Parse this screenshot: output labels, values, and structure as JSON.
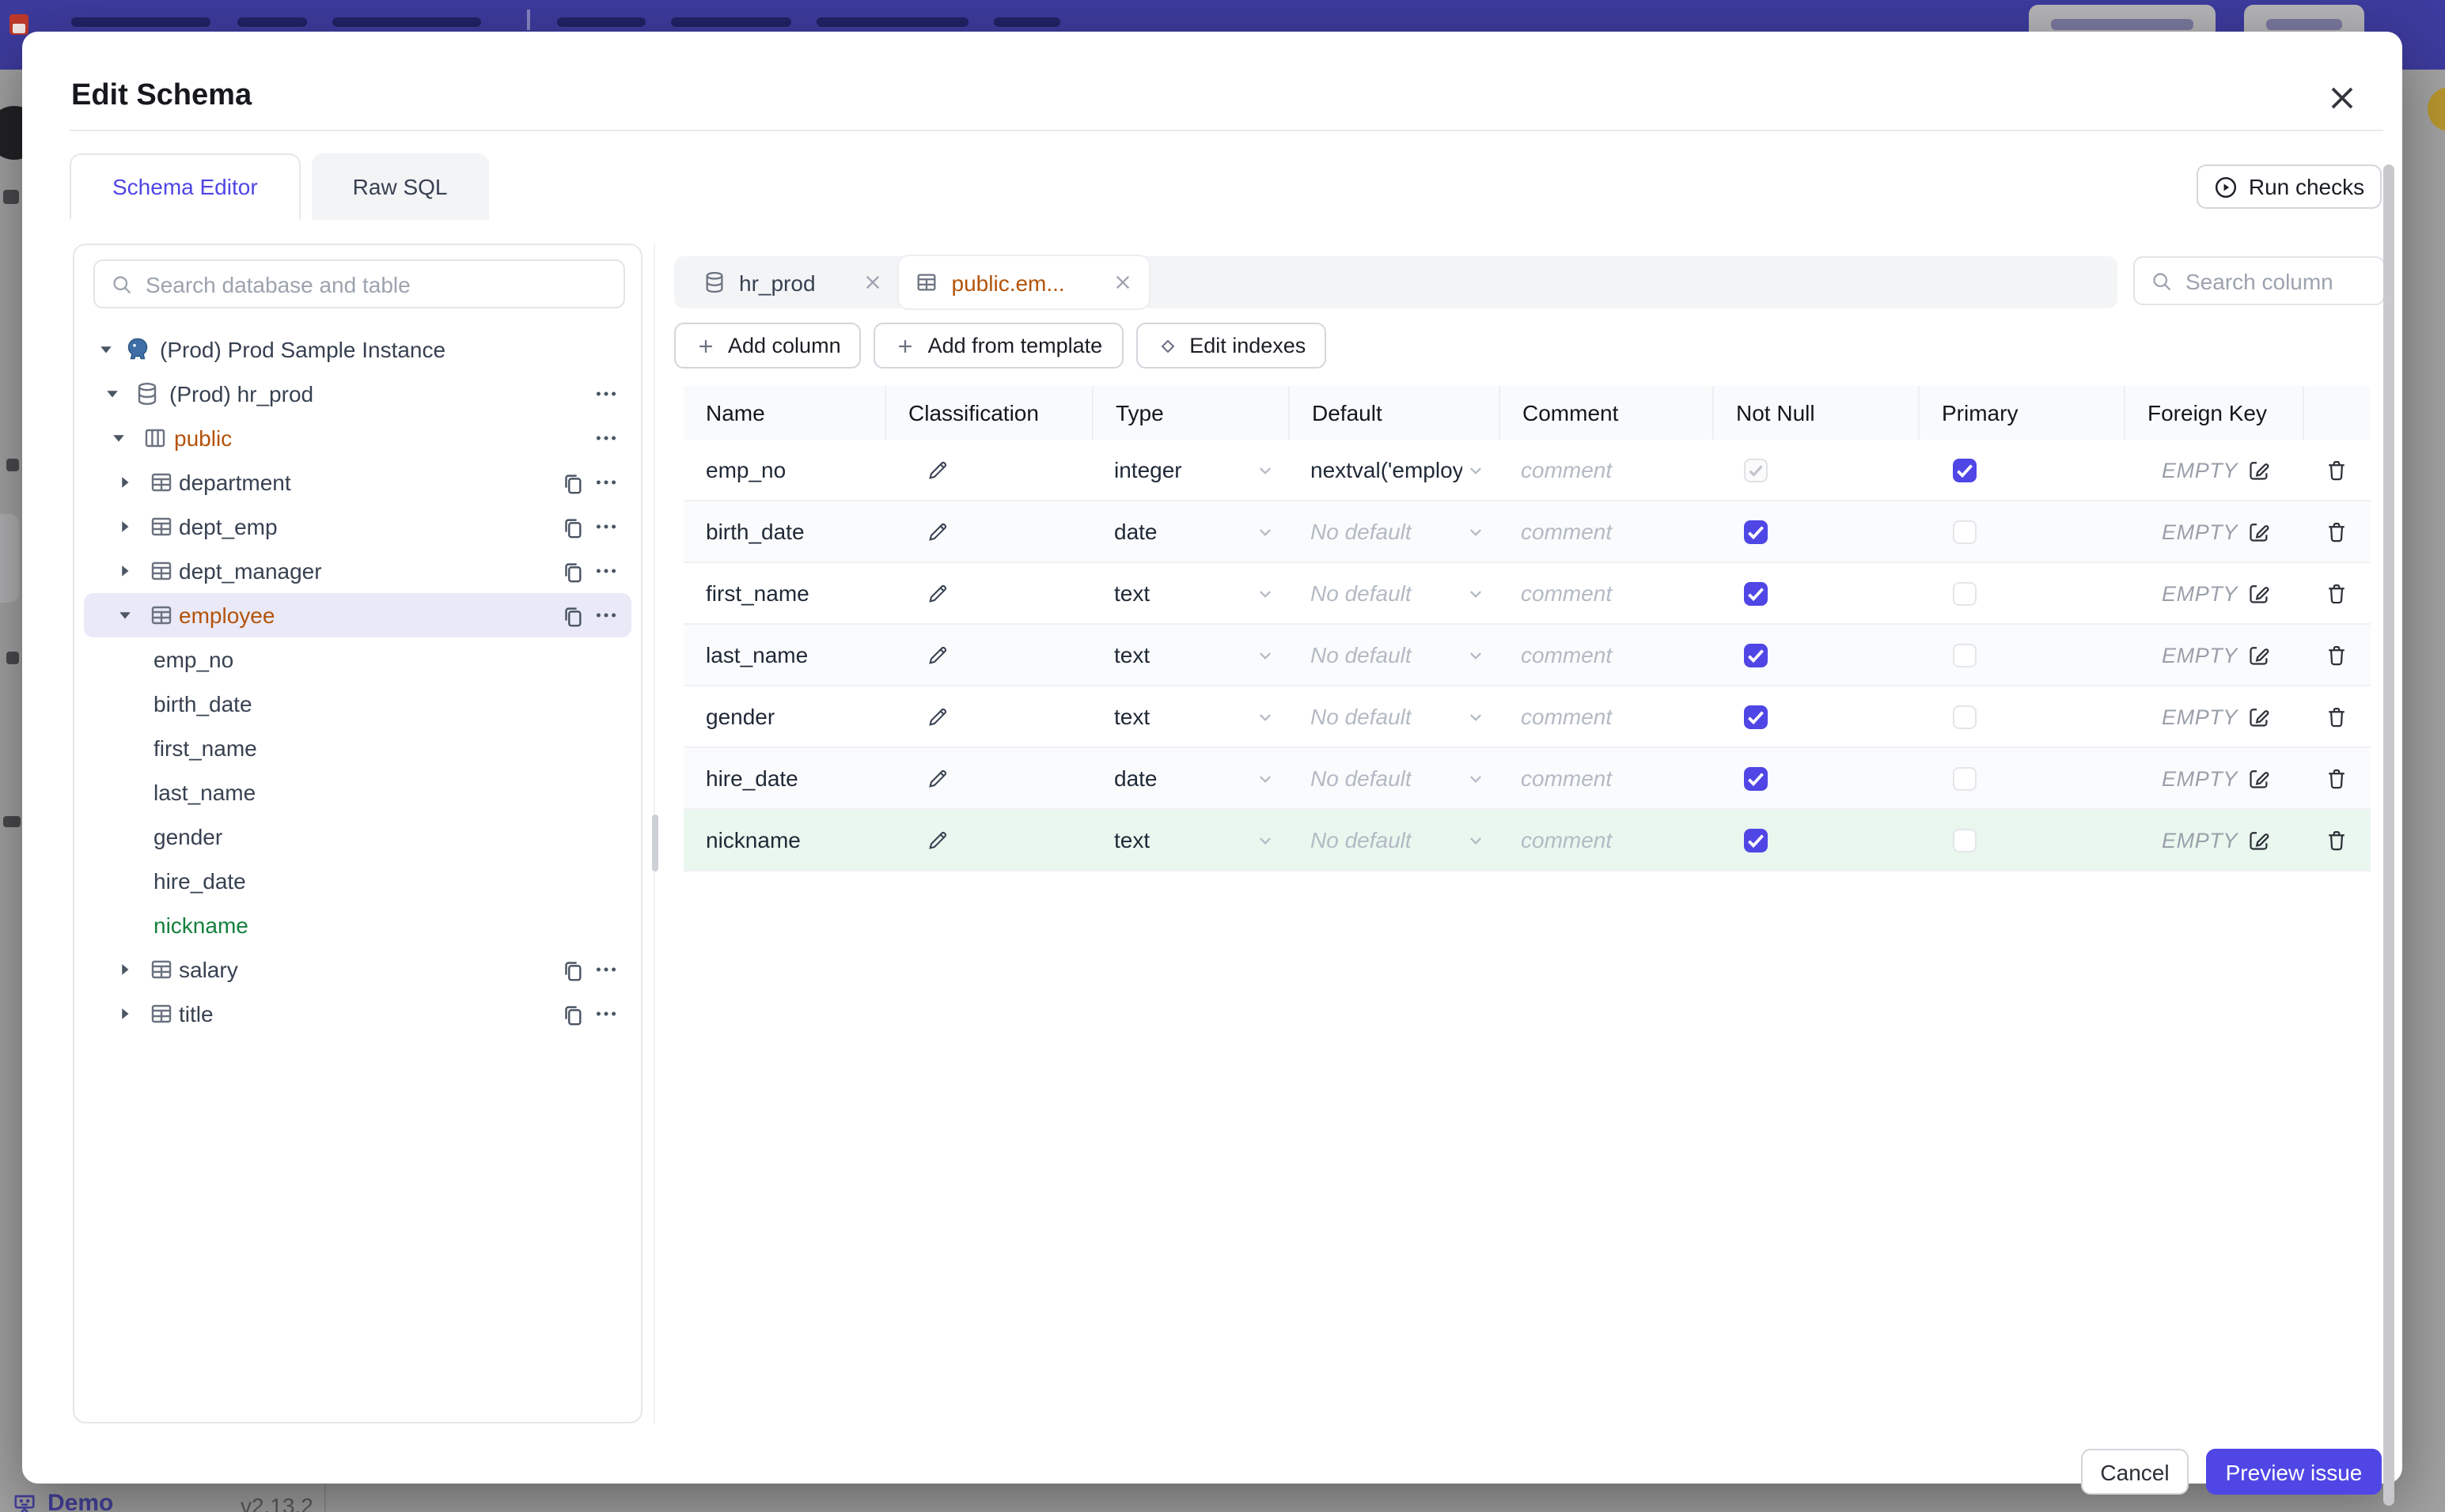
{
  "colors": {
    "accent": "#4f46e5",
    "header_bar": "#3d3b9d",
    "orange_modified": "#b45309",
    "green_new": "#15803d",
    "green_row_bg": "#e9f7ef",
    "selected_tree_bg": "#e9e9f8"
  },
  "modal": {
    "title": "Edit Schema",
    "tabs": [
      {
        "label": "Schema Editor",
        "active": true
      },
      {
        "label": "Raw SQL",
        "active": false
      }
    ],
    "run_checks_label": "Run checks",
    "sidebar": {
      "search_placeholder": "Search database and table",
      "tree": [
        {
          "level": 1,
          "caret": "down",
          "icon": "postgres",
          "label": "(Prod) Prod Sample Instance",
          "color": "default",
          "copy": false,
          "dots": false,
          "selected": false
        },
        {
          "level": 2,
          "caret": "down",
          "icon": "database",
          "label": "(Prod) hr_prod",
          "color": "default",
          "copy": false,
          "dots": true,
          "selected": false
        },
        {
          "level": 3,
          "caret": "down",
          "icon": "schema",
          "label": "public",
          "color": "orange",
          "copy": false,
          "dots": true,
          "selected": false
        },
        {
          "level": 4,
          "caret": "right",
          "icon": "table",
          "label": "department",
          "color": "default",
          "copy": true,
          "dots": true,
          "selected": false
        },
        {
          "level": 4,
          "caret": "right",
          "icon": "table",
          "label": "dept_emp",
          "color": "default",
          "copy": true,
          "dots": true,
          "selected": false
        },
        {
          "level": 4,
          "caret": "right",
          "icon": "table",
          "label": "dept_manager",
          "color": "default",
          "copy": true,
          "dots": true,
          "selected": false
        },
        {
          "level": 4,
          "caret": "down",
          "icon": "table",
          "label": "employee",
          "color": "orange",
          "copy": true,
          "dots": true,
          "selected": true
        },
        {
          "level": 5,
          "caret": null,
          "icon": null,
          "label": "emp_no",
          "color": "default",
          "copy": false,
          "dots": false,
          "selected": false
        },
        {
          "level": 5,
          "caret": null,
          "icon": null,
          "label": "birth_date",
          "color": "default",
          "copy": false,
          "dots": false,
          "selected": false
        },
        {
          "level": 5,
          "caret": null,
          "icon": null,
          "label": "first_name",
          "color": "default",
          "copy": false,
          "dots": false,
          "selected": false
        },
        {
          "level": 5,
          "caret": null,
          "icon": null,
          "label": "last_name",
          "color": "default",
          "copy": false,
          "dots": false,
          "selected": false
        },
        {
          "level": 5,
          "caret": null,
          "icon": null,
          "label": "gender",
          "color": "default",
          "copy": false,
          "dots": false,
          "selected": false
        },
        {
          "level": 5,
          "caret": null,
          "icon": null,
          "label": "hire_date",
          "color": "default",
          "copy": false,
          "dots": false,
          "selected": false
        },
        {
          "level": 5,
          "caret": null,
          "icon": null,
          "label": "nickname",
          "color": "green",
          "copy": false,
          "dots": false,
          "selected": false
        },
        {
          "level": 4,
          "caret": "right",
          "icon": "table",
          "label": "salary",
          "color": "default",
          "copy": true,
          "dots": true,
          "selected": false
        },
        {
          "level": 4,
          "caret": "right",
          "icon": "table",
          "label": "title",
          "color": "default",
          "copy": true,
          "dots": true,
          "selected": false
        }
      ]
    },
    "editor": {
      "chips": [
        {
          "label": "hr_prod",
          "icon": "database",
          "active": false
        },
        {
          "label": "public.em...",
          "icon": "table",
          "active": true
        }
      ],
      "column_search_placeholder": "Search column",
      "toolbar": [
        {
          "icon": "plus",
          "label": "Add column"
        },
        {
          "icon": "plus",
          "label": "Add from template"
        },
        {
          "icon": "diamond",
          "label": "Edit indexes"
        }
      ],
      "table": {
        "headers": [
          "Name",
          "Classification",
          "Type",
          "Default",
          "Comment",
          "Not Null",
          "Primary",
          "Foreign Key"
        ],
        "comment_placeholder": "comment",
        "fk_empty_label": "EMPTY",
        "rows": [
          {
            "name": "emp_no",
            "type": "integer",
            "default": "nextval('employ",
            "default_is_placeholder": false,
            "comment": "",
            "not_null_checked": true,
            "not_null_disabled": true,
            "primary": true,
            "new_row": false
          },
          {
            "name": "birth_date",
            "type": "date",
            "default": "No default",
            "default_is_placeholder": true,
            "comment": "",
            "not_null_checked": true,
            "not_null_disabled": false,
            "primary": false,
            "new_row": false
          },
          {
            "name": "first_name",
            "type": "text",
            "default": "No default",
            "default_is_placeholder": true,
            "comment": "",
            "not_null_checked": true,
            "not_null_disabled": false,
            "primary": false,
            "new_row": false
          },
          {
            "name": "last_name",
            "type": "text",
            "default": "No default",
            "default_is_placeholder": true,
            "comment": "",
            "not_null_checked": true,
            "not_null_disabled": false,
            "primary": false,
            "new_row": false
          },
          {
            "name": "gender",
            "type": "text",
            "default": "No default",
            "default_is_placeholder": true,
            "comment": "",
            "not_null_checked": true,
            "not_null_disabled": false,
            "primary": false,
            "new_row": false
          },
          {
            "name": "hire_date",
            "type": "date",
            "default": "No default",
            "default_is_placeholder": true,
            "comment": "",
            "not_null_checked": true,
            "not_null_disabled": false,
            "primary": false,
            "new_row": false
          },
          {
            "name": "nickname",
            "type": "text",
            "default": "No default",
            "default_is_placeholder": true,
            "comment": "",
            "not_null_checked": true,
            "not_null_disabled": false,
            "primary": false,
            "new_row": true
          }
        ]
      }
    },
    "footer": {
      "cancel_label": "Cancel",
      "submit_label": "Preview issue"
    }
  },
  "background": {
    "bottom_bar": {
      "demo_label": "Demo",
      "version": "v2.13.2"
    }
  }
}
